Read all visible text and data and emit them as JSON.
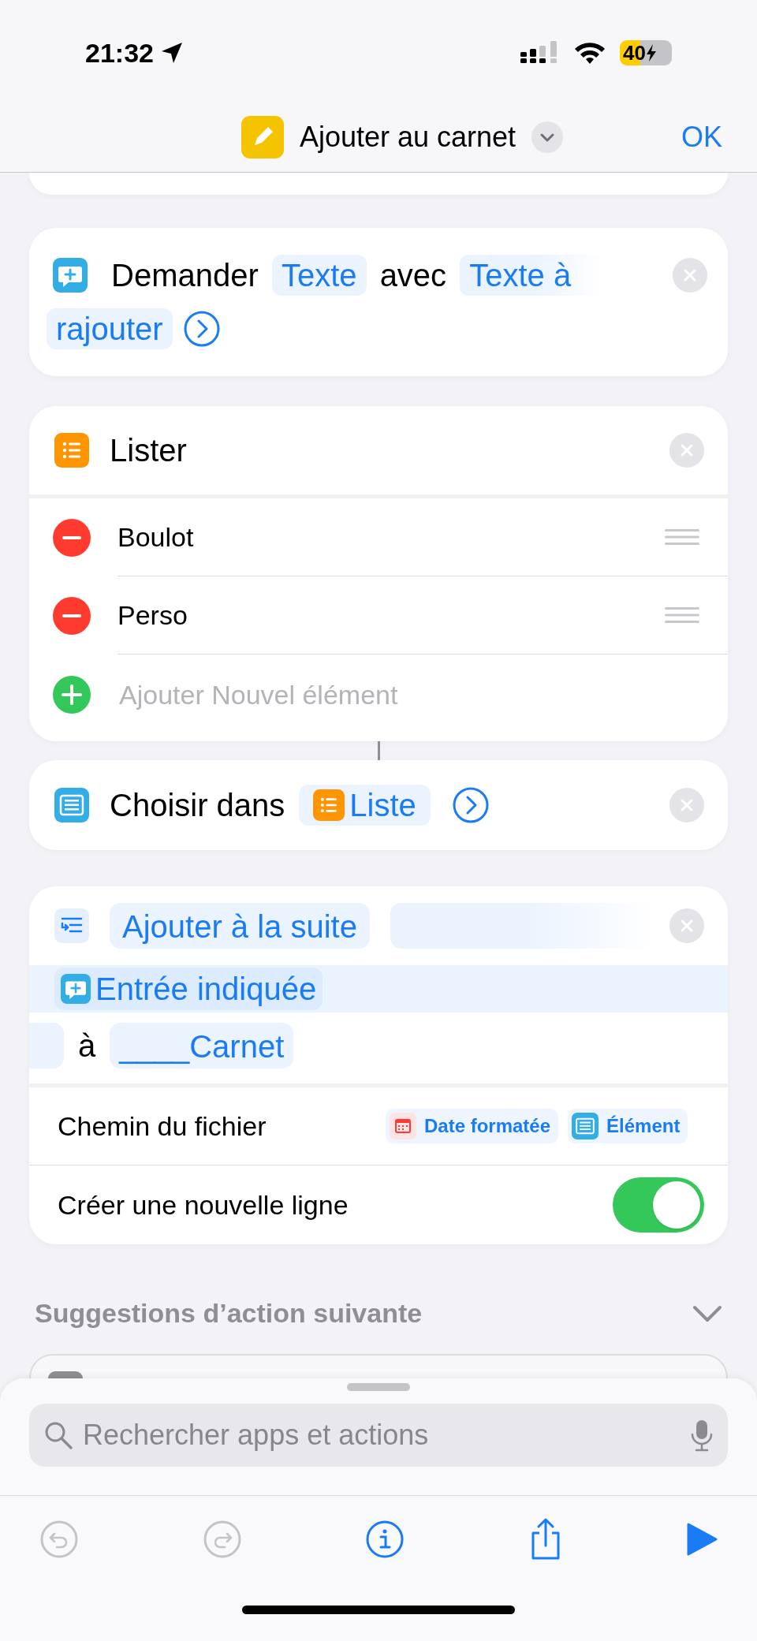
{
  "status_bar": {
    "time": "21:32",
    "battery": "40"
  },
  "nav": {
    "title": "Ajouter au carnet",
    "done": "OK"
  },
  "actions": [
    {
      "kind": "ask",
      "words": [
        {
          "kind": "label",
          "text": "Demander"
        },
        {
          "kind": "token",
          "text": "Texte"
        },
        {
          "kind": "label",
          "text": "avec"
        },
        {
          "kind": "token",
          "lines": [
            "Texte à",
            "rajouter"
          ]
        }
      ]
    },
    {
      "kind": "list",
      "title": "Lister",
      "items": [
        "Boulot",
        "Perso"
      ],
      "add_placeholder": "Ajouter Nouvel élément"
    },
    {
      "kind": "choose",
      "label": "Choisir dans",
      "token": "Liste"
    },
    {
      "kind": "append",
      "token": "Ajouter à la suite",
      "input_token": "Entrée indiquée",
      "preposition": "à",
      "target_token": "____Carnet",
      "path_label": "Chemin du fichier",
      "path_tokens": [
        {
          "kind": "date",
          "text": "Date formatée"
        },
        {
          "kind": "item",
          "text": "Élément"
        }
      ],
      "newline_label": "Créer une nouvelle ligne",
      "newline_on": true
    }
  ],
  "suggestions": {
    "title": "Suggestions d’action suivante"
  },
  "search": {
    "placeholder": "Rechercher apps et actions"
  },
  "toolbar": [
    {
      "kind": "undo",
      "disabled": true
    },
    {
      "kind": "redo",
      "disabled": true
    },
    {
      "kind": "info",
      "disabled": false
    },
    {
      "kind": "share",
      "disabled": false
    },
    {
      "kind": "run",
      "disabled": false
    }
  ]
}
